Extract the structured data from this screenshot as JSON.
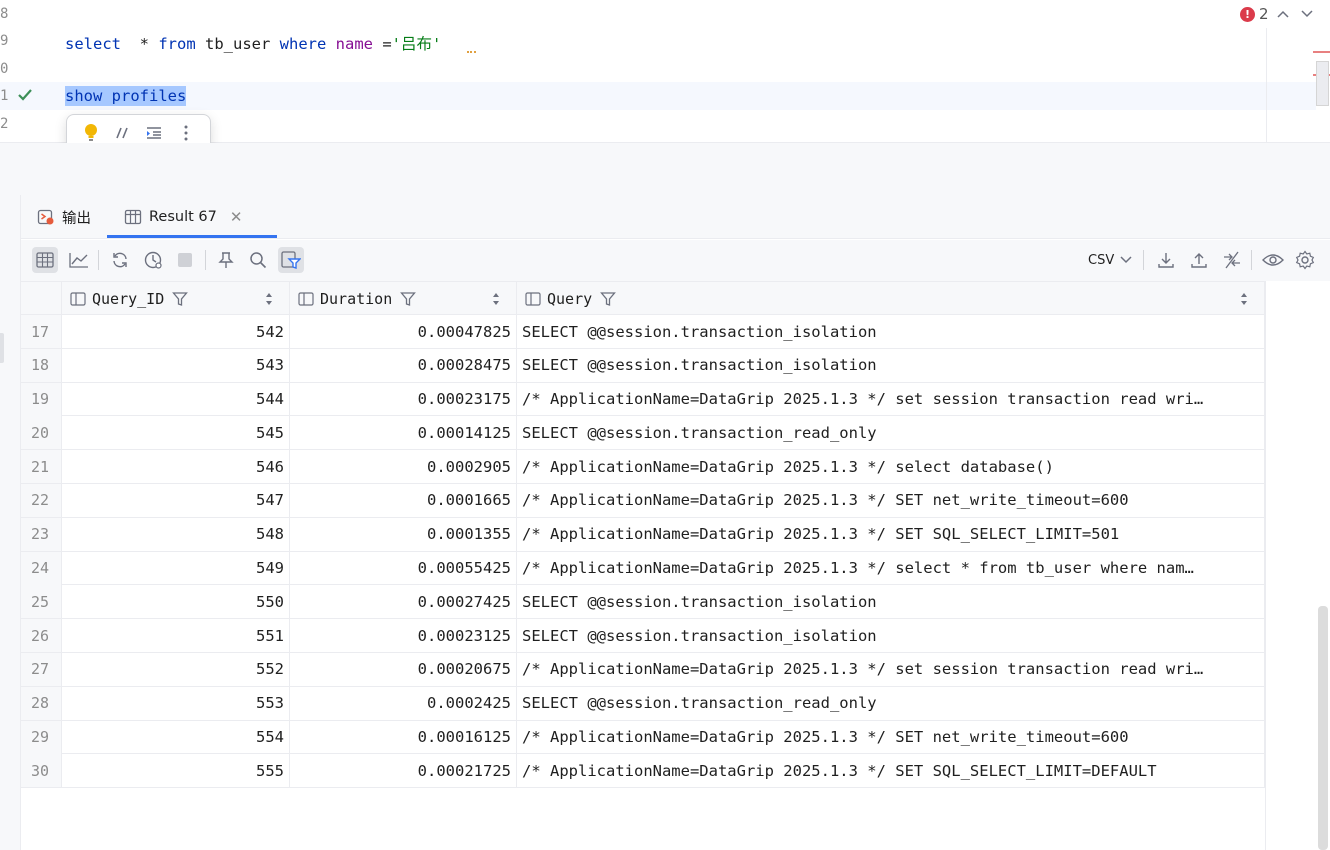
{
  "editor": {
    "gutter": [
      "8",
      "9",
      "0",
      "1",
      "2"
    ],
    "line9": {
      "kw1": "select",
      "star": "  * ",
      "kw2": "from",
      "table": " tb_user ",
      "kw3": "where",
      "col": " name",
      "op": " =",
      "str": "'吕布'"
    },
    "line11": {
      "text": "show profiles"
    },
    "inspection": {
      "error_count": "2"
    }
  },
  "floating_toolbar": {
    "icons": [
      "bulb-icon",
      "comment-icon",
      "indent-icon",
      "more-icon"
    ]
  },
  "tabs": [
    {
      "label": "输出",
      "icon": "output-icon"
    },
    {
      "label": "Result 67",
      "icon": "table-icon"
    }
  ],
  "toolbar": {
    "export_format": "CSV",
    "icons": [
      "table-view-icon",
      "chart-icon",
      "refresh-icon",
      "history-icon",
      "stop-icon",
      "pin-icon",
      "search-icon",
      "filter-icon",
      "download-icon",
      "upload-icon",
      "compare-icon",
      "view-icon",
      "settings-icon"
    ]
  },
  "grid": {
    "columns": [
      "Query_ID",
      "Duration",
      "Query"
    ],
    "rows": [
      {
        "n": "17",
        "id": "542",
        "dur": "0.00047825",
        "q": "SELECT @@session.transaction_isolation"
      },
      {
        "n": "18",
        "id": "543",
        "dur": "0.00028475",
        "q": "SELECT @@session.transaction_isolation"
      },
      {
        "n": "19",
        "id": "544",
        "dur": "0.00023175",
        "q": "/* ApplicationName=DataGrip 2025.1.3 */ set session transaction read wri…"
      },
      {
        "n": "20",
        "id": "545",
        "dur": "0.00014125",
        "q": "SELECT @@session.transaction_read_only"
      },
      {
        "n": "21",
        "id": "546",
        "dur": "0.0002905",
        "q": "/* ApplicationName=DataGrip 2025.1.3 */ select database()"
      },
      {
        "n": "22",
        "id": "547",
        "dur": "0.0001665",
        "q": "/* ApplicationName=DataGrip 2025.1.3 */ SET net_write_timeout=600"
      },
      {
        "n": "23",
        "id": "548",
        "dur": "0.0001355",
        "q": "/* ApplicationName=DataGrip 2025.1.3 */ SET SQL_SELECT_LIMIT=501"
      },
      {
        "n": "24",
        "id": "549",
        "dur": "0.00055425",
        "q": "/* ApplicationName=DataGrip 2025.1.3 */ select  * from tb_user where nam…"
      },
      {
        "n": "25",
        "id": "550",
        "dur": "0.00027425",
        "q": "SELECT @@session.transaction_isolation"
      },
      {
        "n": "26",
        "id": "551",
        "dur": "0.00023125",
        "q": "SELECT @@session.transaction_isolation"
      },
      {
        "n": "27",
        "id": "552",
        "dur": "0.00020675",
        "q": "/* ApplicationName=DataGrip 2025.1.3 */ set session transaction read wri…"
      },
      {
        "n": "28",
        "id": "553",
        "dur": "0.0002425",
        "q": "SELECT @@session.transaction_read_only"
      },
      {
        "n": "29",
        "id": "554",
        "dur": "0.00016125",
        "q": "/* ApplicationName=DataGrip 2025.1.3 */ SET net_write_timeout=600"
      },
      {
        "n": "30",
        "id": "555",
        "dur": "0.00021725",
        "q": "/* ApplicationName=DataGrip 2025.1.3 */ SET SQL_SELECT_LIMIT=DEFAULT"
      }
    ]
  },
  "colors": {
    "accent": "#3574f0",
    "keyword": "#0033b3",
    "string": "#067d17",
    "column": "#871094",
    "error": "#db3b4b"
  }
}
